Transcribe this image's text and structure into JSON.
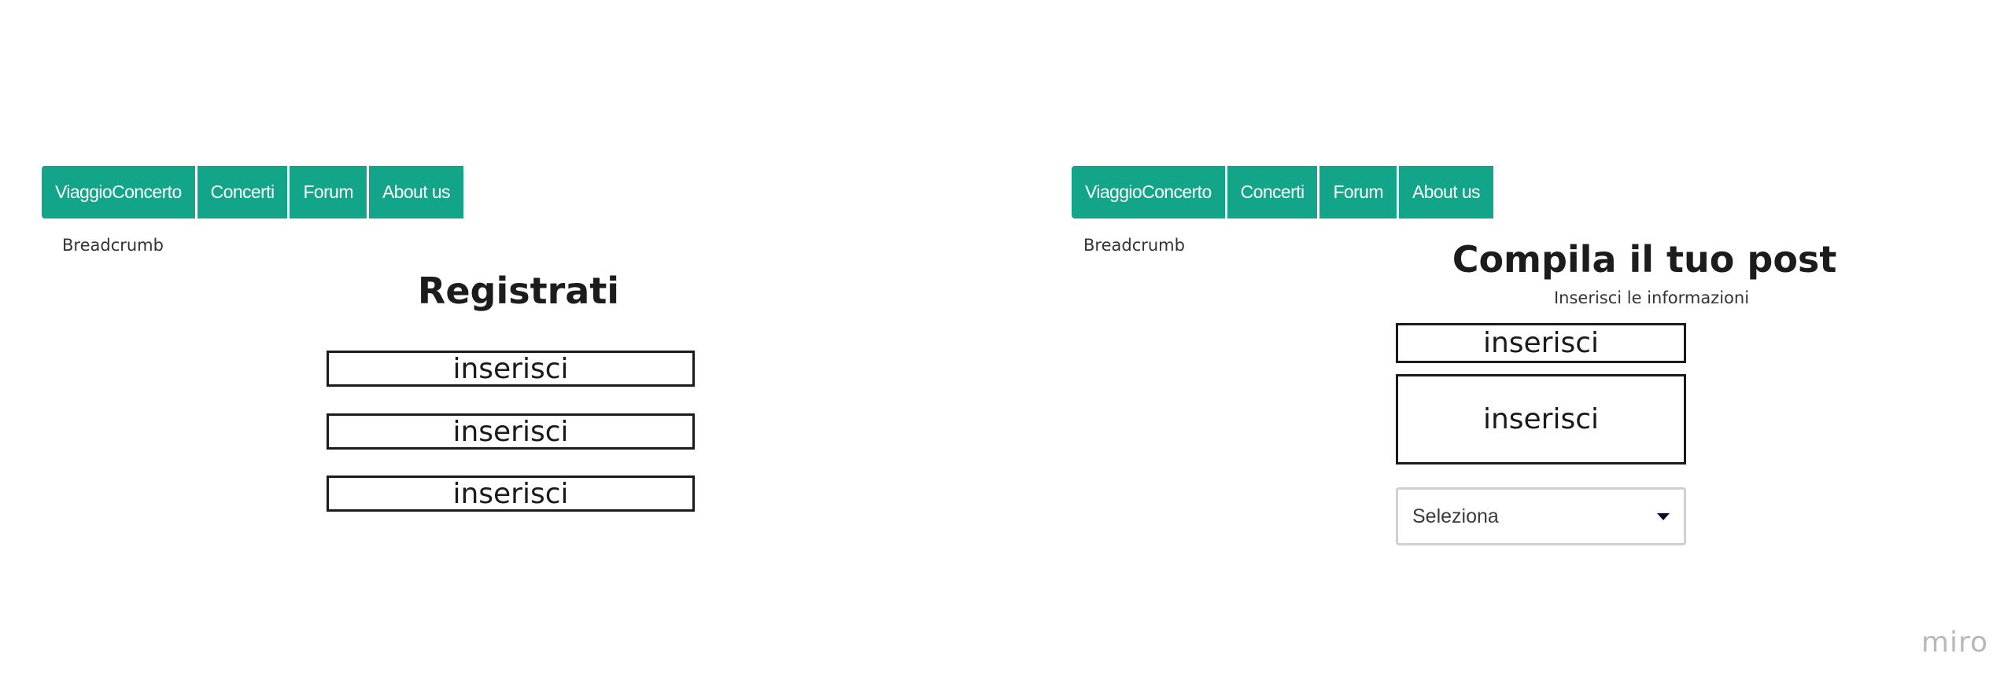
{
  "brand": {
    "accent": "#12a58a",
    "watermark": "miro"
  },
  "left_frame": {
    "nav": [
      "ViaggioConcerto",
      "Concerti",
      "Forum",
      "About us"
    ],
    "breadcrumb": "Breadcrumb",
    "title": "Registrati",
    "fields": [
      "inserisci",
      "inserisci",
      "inserisci"
    ]
  },
  "right_frame": {
    "nav": [
      "ViaggioConcerto",
      "Concerti",
      "Forum",
      "About us"
    ],
    "breadcrumb": "Breadcrumb",
    "title": "Compila il tuo post",
    "subtitle": "Inserisci le informazioni",
    "fields": [
      "inserisci",
      "inserisci"
    ],
    "select": {
      "value": "Seleziona",
      "icon": "caret-down-icon"
    }
  }
}
